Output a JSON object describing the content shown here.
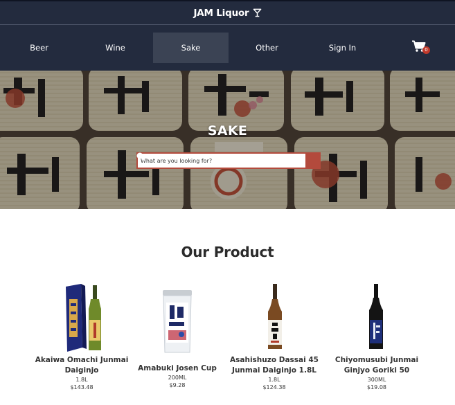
{
  "header": {
    "brand": "JAM Liquor",
    "brand_icon": "cocktail-glass-icon"
  },
  "nav": {
    "items": [
      {
        "label": "Beer",
        "active": false
      },
      {
        "label": "Wine",
        "active": false
      },
      {
        "label": "Sake",
        "active": true
      },
      {
        "label": "Other",
        "active": false
      },
      {
        "label": "Sign In",
        "active": false
      }
    ],
    "cart_icon": "shopping-cart-icon",
    "cart_count": "0"
  },
  "hero": {
    "title": "SAKE",
    "search_placeholder": "What are you looking for?",
    "search_icon": "search-icon"
  },
  "products_section": {
    "title": "Our Product",
    "items": [
      {
        "name": "Akaiwa Omachi Junmai Daiginjo",
        "size": "1.8L",
        "price": "$143.48"
      },
      {
        "name": "Amabuki Josen Cup",
        "size": "200ML",
        "price": "$9.28"
      },
      {
        "name": "Asahishuzo Dassai 45 Junmai Daiginjo 1.8L",
        "size": "1.8L",
        "price": "$124.38"
      },
      {
        "name": "Chiyomusubi Junmai Ginjyo Goriki 50",
        "size": "300ML",
        "price": "$19.08"
      }
    ]
  },
  "colors": {
    "nav_bg": "#232b3e",
    "nav_active": "#3b4354",
    "accent": "#b34a3c",
    "badge": "#c0392b"
  }
}
